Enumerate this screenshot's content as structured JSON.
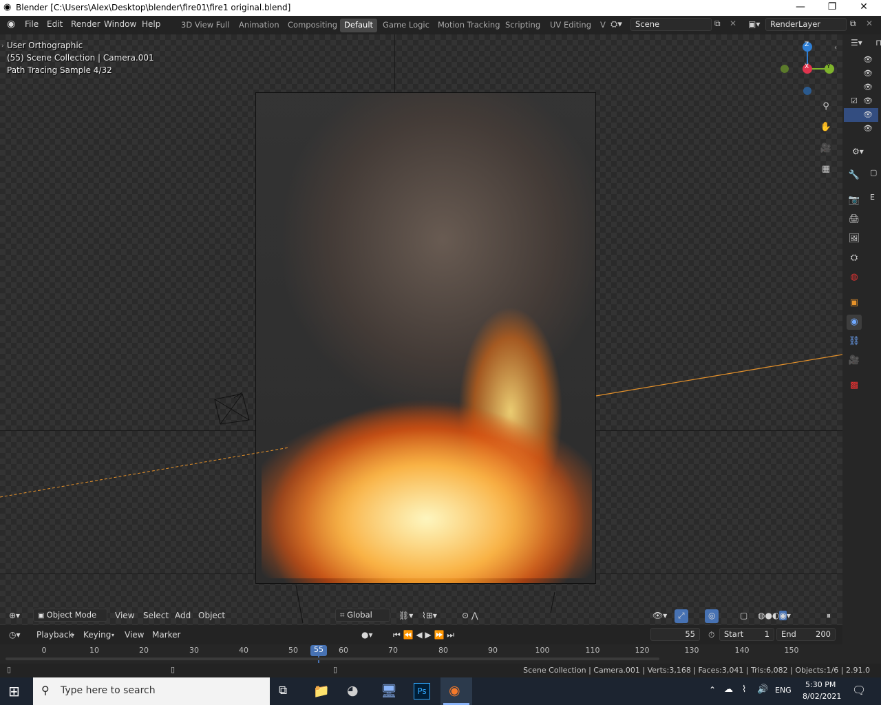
{
  "window": {
    "title": "Blender [C:\\Users\\Alex\\Desktop\\blender\\fire01\\fire1 original.blend]",
    "minimize": "—",
    "maximize": "❐",
    "close": "✕"
  },
  "menu": [
    "File",
    "Edit",
    "Render",
    "Window",
    "Help"
  ],
  "workspaces": [
    {
      "label": "3D View Full",
      "active": false
    },
    {
      "label": "Animation",
      "active": false
    },
    {
      "label": "Compositing",
      "active": false
    },
    {
      "label": "Default",
      "active": true
    },
    {
      "label": "Game Logic",
      "active": false
    },
    {
      "label": "Motion Tracking",
      "active": false
    },
    {
      "label": "Scripting",
      "active": false
    },
    {
      "label": "UV Editing",
      "active": false
    },
    {
      "label": "V",
      "active": false
    }
  ],
  "scene": {
    "value": "Scene"
  },
  "render_layer": {
    "value": "RenderLayer"
  },
  "viewport": {
    "view_name": "User Orthographic",
    "collection_info": "(55) Scene Collection | Camera.001",
    "render_status": "Path Tracing Sample 4/32",
    "gizmo": {
      "z": "Z",
      "x": "X",
      "y": "Y"
    }
  },
  "header3d": {
    "mode": "Object Mode",
    "view": "View",
    "select": "Select",
    "add": "Add",
    "object": "Object",
    "orientation": "Global"
  },
  "timeline": {
    "playback": "Playback",
    "keying": "Keying",
    "view": "View",
    "marker": "Marker",
    "current_frame": "55",
    "start_label": "Start",
    "start_value": "1",
    "end_label": "End",
    "end_value": "200",
    "ticks": [
      "0",
      "10",
      "20",
      "30",
      "40",
      "50",
      "60",
      "70",
      "80",
      "90",
      "100",
      "110",
      "120",
      "130",
      "140",
      "150"
    ],
    "current_tick": "55"
  },
  "statusbar": {
    "text": "Scene Collection | Camera.001 | Verts:3,168 | Faces:3,041 | Tris:6,082 | Objects:1/6 | 2.91.0"
  },
  "taskbar": {
    "search_placeholder": "Type here to search",
    "lang": "ENG",
    "time": "5:30 PM",
    "date": "8/02/2021"
  },
  "colors": {
    "accent": "#4772b3",
    "active_frame": "#4772b3",
    "selection_line": "#e8932a"
  }
}
